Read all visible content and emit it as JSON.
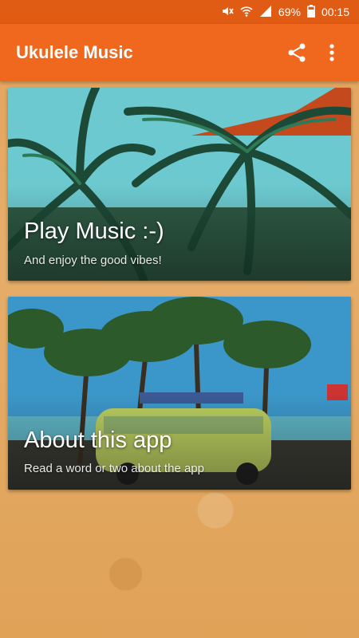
{
  "status_bar": {
    "battery_percent": "69%",
    "time": "00:15",
    "icons": [
      "mute-icon",
      "wifi-icon",
      "signal-icon",
      "battery-icon"
    ]
  },
  "app_bar": {
    "title": "Ukulele Music",
    "actions": [
      "share-icon",
      "overflow-menu-icon"
    ]
  },
  "cards": [
    {
      "title": "Play Music :-)",
      "subtitle": "And enjoy the good vibes!"
    },
    {
      "title": "About this app",
      "subtitle": "Read a word or two about the app"
    }
  ],
  "colors": {
    "primary": "#f0681e",
    "primary_dark": "#e05c14",
    "background": "#e3a35c"
  }
}
